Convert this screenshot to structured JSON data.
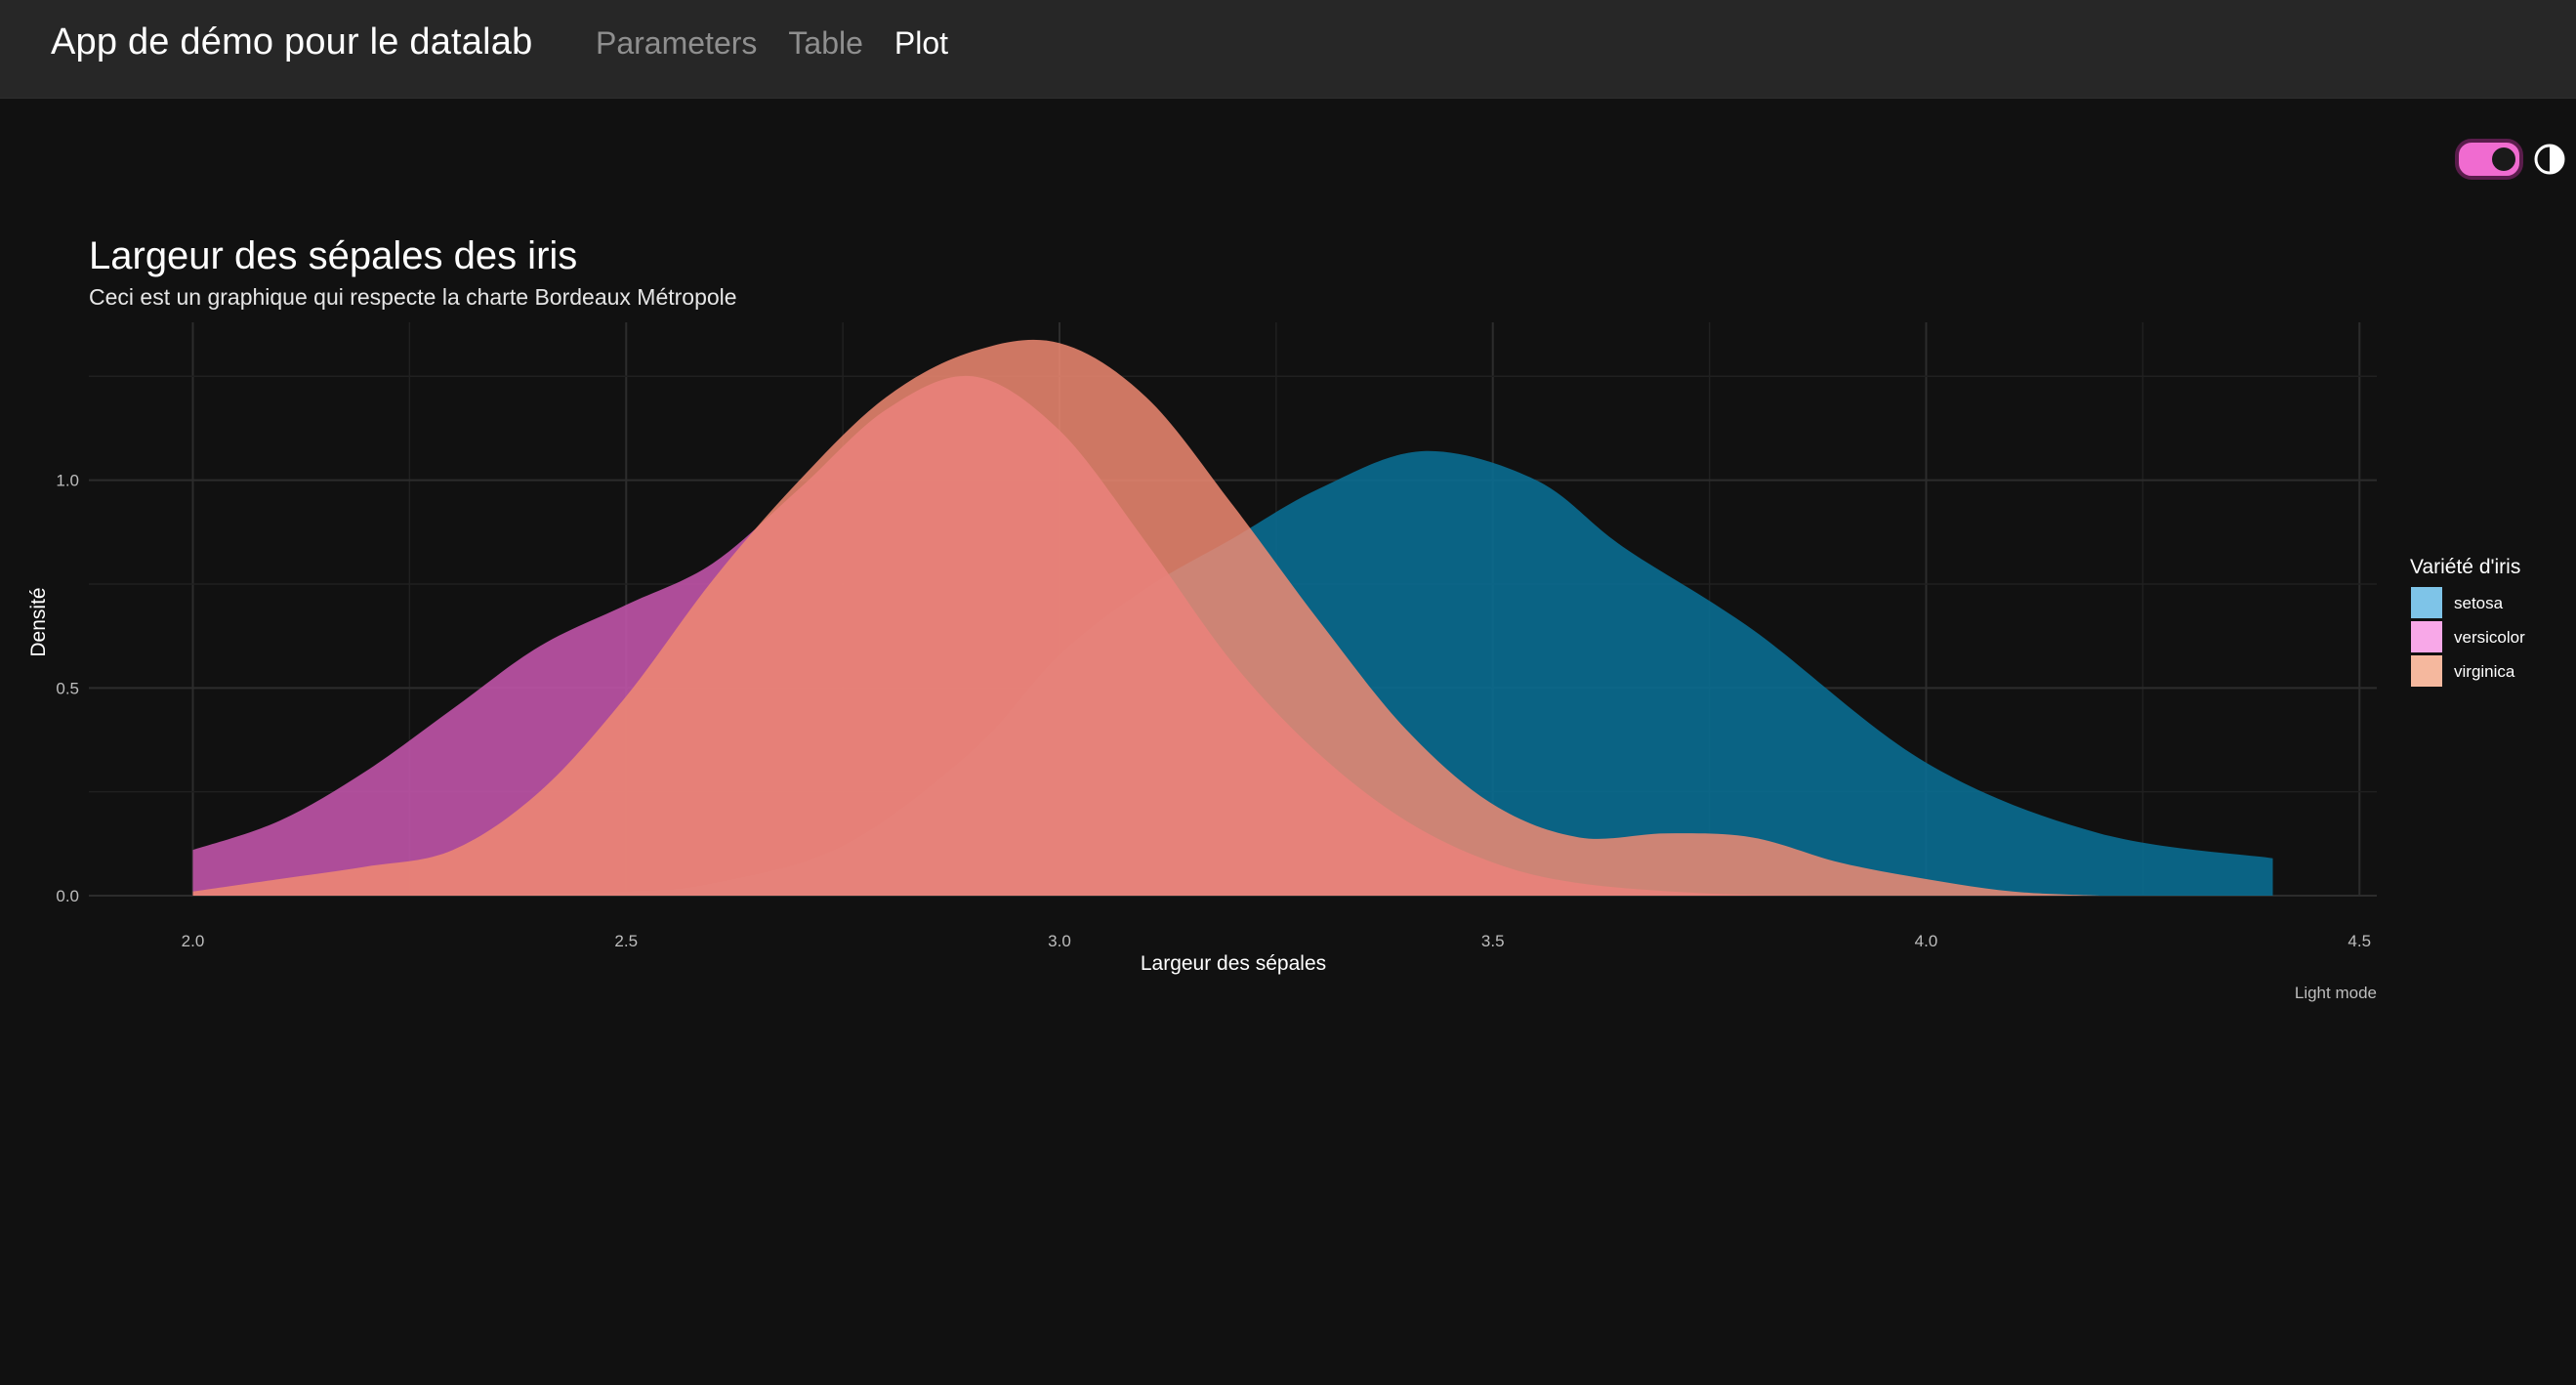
{
  "app": {
    "title": "App de démo pour le datalab",
    "nav": [
      {
        "label": "Parameters",
        "active": false
      },
      {
        "label": "Table",
        "active": false
      },
      {
        "label": "Plot",
        "active": true
      }
    ]
  },
  "theme_toggle": {
    "state": "on",
    "icon": "contrast-icon",
    "accent": "#f06bd0"
  },
  "chart_data": {
    "type": "area",
    "title": "Largeur des sépales des iris",
    "subtitle": "Ceci est un graphique qui respecte la charte Bordeaux Métropole",
    "xlabel": "Largeur des sépales",
    "ylabel": "Densité",
    "caption": "Light mode",
    "xlim": [
      1.88,
      4.52
    ],
    "ylim": [
      0,
      1.38
    ],
    "x_ticks": [
      "2.0",
      "2.5",
      "3.0",
      "3.5",
      "4.0",
      "4.5"
    ],
    "y_ticks": [
      "0.0",
      "0.5",
      "1.0"
    ],
    "grid": true,
    "legend": {
      "title": "Variété d'iris",
      "position": "right"
    },
    "series": [
      {
        "name": "setosa",
        "color": "#0a6d91",
        "swatch": "#7ec4e8",
        "opacity": 0.9,
        "points": [
          [
            2.3,
            0.0
          ],
          [
            2.5,
            0.01
          ],
          [
            2.6,
            0.03
          ],
          [
            2.75,
            0.12
          ],
          [
            2.9,
            0.35
          ],
          [
            3.0,
            0.58
          ],
          [
            3.1,
            0.74
          ],
          [
            3.2,
            0.86
          ],
          [
            3.3,
            0.98
          ],
          [
            3.42,
            1.07
          ],
          [
            3.55,
            1.0
          ],
          [
            3.65,
            0.84
          ],
          [
            3.8,
            0.64
          ],
          [
            4.0,
            0.32
          ],
          [
            4.2,
            0.15
          ],
          [
            4.4,
            0.09
          ]
        ]
      },
      {
        "name": "versicolor",
        "color": "#c054a8",
        "swatch": "#f8a8e8",
        "opacity": 0.9,
        "points": [
          [
            2.0,
            0.11
          ],
          [
            2.1,
            0.18
          ],
          [
            2.2,
            0.3
          ],
          [
            2.3,
            0.45
          ],
          [
            2.4,
            0.6
          ],
          [
            2.5,
            0.7
          ],
          [
            2.6,
            0.8
          ],
          [
            2.7,
            0.98
          ],
          [
            2.8,
            1.17
          ],
          [
            2.9,
            1.25
          ],
          [
            3.0,
            1.12
          ],
          [
            3.1,
            0.85
          ],
          [
            3.2,
            0.56
          ],
          [
            3.3,
            0.34
          ],
          [
            3.4,
            0.18
          ],
          [
            3.5,
            0.08
          ],
          [
            3.6,
            0.03
          ],
          [
            3.75,
            0.005
          ],
          [
            3.9,
            0.0
          ]
        ]
      },
      {
        "name": "virginica",
        "color": "#f08a72",
        "swatch": "#f5b89e",
        "opacity": 0.85,
        "points": [
          [
            2.0,
            0.01
          ],
          [
            2.1,
            0.04
          ],
          [
            2.2,
            0.07
          ],
          [
            2.3,
            0.11
          ],
          [
            2.4,
            0.25
          ],
          [
            2.5,
            0.48
          ],
          [
            2.6,
            0.76
          ],
          [
            2.7,
            1.0
          ],
          [
            2.8,
            1.2
          ],
          [
            2.9,
            1.31
          ],
          [
            3.0,
            1.33
          ],
          [
            3.1,
            1.2
          ],
          [
            3.2,
            0.94
          ],
          [
            3.3,
            0.66
          ],
          [
            3.4,
            0.4
          ],
          [
            3.5,
            0.22
          ],
          [
            3.6,
            0.14
          ],
          [
            3.7,
            0.15
          ],
          [
            3.8,
            0.14
          ],
          [
            3.9,
            0.08
          ],
          [
            4.0,
            0.04
          ],
          [
            4.1,
            0.01
          ],
          [
            4.2,
            0.0
          ]
        ]
      }
    ]
  }
}
